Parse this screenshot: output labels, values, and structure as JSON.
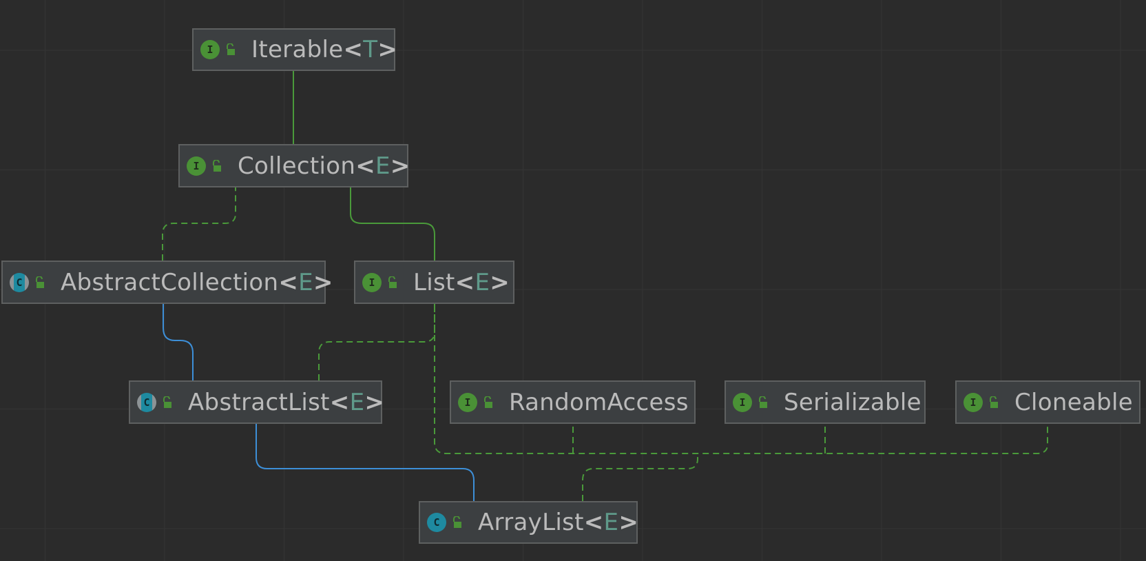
{
  "colors": {
    "background": "#2b2b2b",
    "node_fill": "#3c3f41",
    "node_border": "#5e6060",
    "interface_badge": "#4a9136",
    "class_badge": "#1e8aa0",
    "extends_edge": "#3d8fd8",
    "implements_edge": "#4a9a3a",
    "type_parameter": "#5f9a8a",
    "name_text": "#bbbbbb"
  },
  "nodes": {
    "iterable": {
      "badge": "I",
      "kind": "interface",
      "name": "Iterable",
      "open": "<",
      "param": "T",
      "close": ">"
    },
    "collection": {
      "badge": "I",
      "kind": "interface",
      "name": "Collection",
      "open": "<",
      "param": "E",
      "close": ">"
    },
    "abstract_collection": {
      "badge": "C",
      "kind": "abstract-class",
      "name": "AbstractCollection",
      "open": "<",
      "param": "E",
      "close": ">"
    },
    "list": {
      "badge": "I",
      "kind": "interface",
      "name": "List",
      "open": "<",
      "param": "E",
      "close": ">"
    },
    "abstract_list": {
      "badge": "C",
      "kind": "abstract-class",
      "name": "AbstractList",
      "open": "<",
      "param": "E",
      "close": ">"
    },
    "random_access": {
      "badge": "I",
      "kind": "interface",
      "name": "RandomAccess"
    },
    "serializable": {
      "badge": "I",
      "kind": "interface",
      "name": "Serializable"
    },
    "cloneable": {
      "badge": "I",
      "kind": "interface",
      "name": "Cloneable"
    },
    "array_list": {
      "badge": "C",
      "kind": "class",
      "name": "ArrayList",
      "open": "<",
      "param": "E",
      "close": ">"
    }
  },
  "edges": [
    {
      "from": "collection",
      "to": "iterable",
      "type": "extends-interface",
      "style": "solid"
    },
    {
      "from": "abstract_collection",
      "to": "collection",
      "type": "implements",
      "style": "dashed"
    },
    {
      "from": "list",
      "to": "collection",
      "type": "extends-interface",
      "style": "solid"
    },
    {
      "from": "abstract_list",
      "to": "abstract_collection",
      "type": "extends-class",
      "style": "solid"
    },
    {
      "from": "abstract_list",
      "to": "list",
      "type": "implements",
      "style": "dashed"
    },
    {
      "from": "array_list",
      "to": "abstract_list",
      "type": "extends-class",
      "style": "solid"
    },
    {
      "from": "array_list",
      "to": "list",
      "type": "implements",
      "style": "dashed"
    },
    {
      "from": "array_list",
      "to": "random_access",
      "type": "implements",
      "style": "dashed"
    },
    {
      "from": "array_list",
      "to": "serializable",
      "type": "implements",
      "style": "dashed"
    },
    {
      "from": "array_list",
      "to": "cloneable",
      "type": "implements",
      "style": "dashed"
    }
  ]
}
